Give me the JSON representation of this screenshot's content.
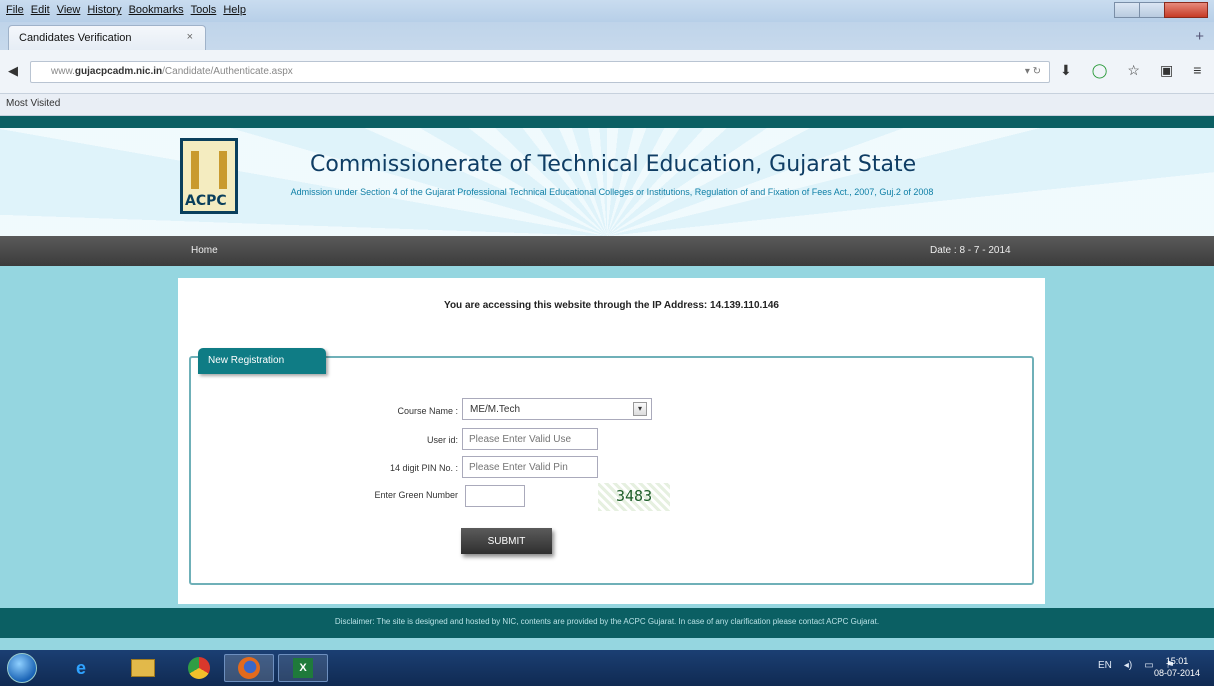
{
  "browser": {
    "menu": [
      "File",
      "Edit",
      "View",
      "History",
      "Bookmarks",
      "Tools",
      "Help"
    ],
    "tab_title": "Candidates Verification",
    "tab_close": "×",
    "url_host": "gujacpcadm.nic.in",
    "url_prefix": "www.",
    "url_path": "/Candidate/Authenticate.aspx",
    "bookmark": "Most Visited"
  },
  "site": {
    "title": "Commissionerate of Technical Education, Gujarat State",
    "subtitle": "Admission under Section 4 of the Gujarat Professional Technical Educational Colleges or Institutions, Regulation of and Fixation of Fees Act., 2007, Guj.2 of 2008",
    "logo_text": "ACPC",
    "nav_home": "Home",
    "date_text": "Date : 8 - 7 - 2014",
    "ip_notice": "You are accessing this website through the IP Address: 14.139.110.146",
    "footer": "Disclaimer: The site is designed and hosted by NIC, contents are provided by the ACPC Gujarat. In case of any clarification please contact ACPC Gujarat."
  },
  "form": {
    "legend": "New Registration",
    "course_label": "Course Name :",
    "course_value": "ME/M.Tech",
    "userid_label": "User id:",
    "userid_placeholder": "Please Enter Valid Use",
    "pin_label": "14 digit PIN No. :",
    "pin_placeholder": "Please Enter Valid Pin",
    "green_label": "Enter Green Number",
    "captcha_text": "3483",
    "submit_label": "SUBMIT"
  },
  "taskbar": {
    "lang": "EN",
    "time": "15:01",
    "date": "08-07-2014"
  }
}
